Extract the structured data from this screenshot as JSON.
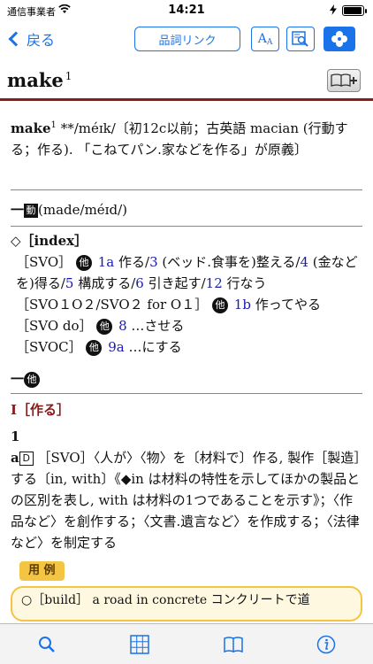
{
  "status": {
    "carrier": "通信事業者",
    "time": "14:21"
  },
  "nav": {
    "back_label": "戻る",
    "link_label": "品詞リンク",
    "font_icon_main": "A",
    "font_icon_sub": "A"
  },
  "headword": {
    "word": "make",
    "superscript": "1"
  },
  "colors": {
    "accent": "#1a73e8",
    "rule": "#8b1a1a",
    "example_bg": "#f4c542"
  },
  "entry": {
    "etym_word": "make",
    "etym_sup": "1",
    "etym_text": "**/méɪk/〔初12c以前；古英語 macian (行動する；作る). 「こねてパン.家などを作る」が原義〕",
    "verb_tag": "動",
    "verb_forms": "(made/méɪd/)",
    "index_label": "◇［index］",
    "index_lines": [
      {
        "pattern": "［SVO］",
        "tag": "他",
        "refs": "1a",
        "text1": "作る/",
        "ref2": "3",
        "text2": " (ベッド.食事を)整える/",
        "ref3": "4",
        "text3": " (金などを)得る/",
        "ref4": "5",
        "text4": " 構成する/",
        "ref5": "6",
        "text5": " 引き起す/",
        "ref6": "12",
        "text6": " 行なう"
      },
      {
        "pattern": "［SVO１O２/SVO２ for O１］",
        "tag": "他",
        "ref": "1b",
        "text": " 作ってやる"
      },
      {
        "pattern": "［SVO do］",
        "tag": "他",
        "ref": "8",
        "text": " …させる"
      },
      {
        "pattern": "［SVOC］",
        "tag": "他",
        "ref": "9a",
        "text": " …にする"
      }
    ],
    "transitive_tag": "他",
    "section_label": "I［作る］",
    "sense_no": "1",
    "sense_letter": "a",
    "sense_tag": "D",
    "sense_text": "［SVO］〈人が〉〈物〉を〔材料で〕作る, 製作［製造］する〔in, with〕《◆in は材料の特性を示してほかの製品との区別を表し, with は材料の1つであることを示す》；〈作品など〉を創作する；〈文書.遺言など〉を作成する；〈法律など〉を制定する",
    "example_label": "用 例",
    "example_text": "○［build］ a road in concrete コンクリートで道"
  },
  "tabs": [
    "search-icon",
    "grid-icon",
    "book-icon",
    "info-icon"
  ]
}
